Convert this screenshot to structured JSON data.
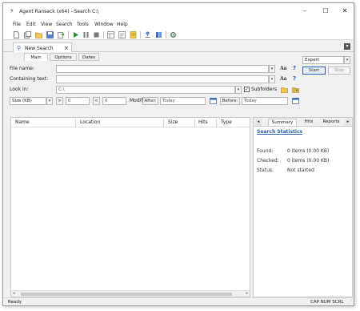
{
  "window": {
    "title": "Agent Ransack (x64) - Search C:\\"
  },
  "menu": [
    "File",
    "Edit",
    "View",
    "Search",
    "Tools",
    "Window",
    "Help"
  ],
  "doc_tab": {
    "label": "New Search",
    "close": "×"
  },
  "criteria": {
    "tabs": [
      "Main",
      "Options",
      "Dates"
    ],
    "file_name_label": "File name:",
    "containing_text_label": "Containing text:",
    "look_in_label": "Look in:",
    "look_in_value": "C:\\",
    "subfolders_label": "Subfolders",
    "size_label": "Size (KB)",
    "size_from": "0",
    "size_to": "0",
    "modified_label": "Modified:",
    "after_label": "After:",
    "after_value": "Today",
    "before_label": "Before:",
    "before_value": "Today",
    "aa_label": "Aa",
    "help_label": "?",
    "gt": ">",
    "lt": "<"
  },
  "mode": {
    "value": "Expert",
    "start": "Start",
    "stop": "Stop"
  },
  "results": {
    "columns": [
      "Name",
      "Location",
      "Size",
      "Hits",
      "Type"
    ]
  },
  "summary": {
    "tabs": [
      "Summary",
      "Hits",
      "Reports"
    ],
    "heading": "Search Statistics",
    "found_label": "Found:",
    "found_value": "0 items (0.00 KB)",
    "checked_label": "Checked:",
    "checked_value": "0 items (0.00 KB)",
    "status_label": "Status:",
    "status_value": "Not started"
  },
  "statusbar": {
    "ready": "Ready",
    "indicators": "CAP NUM SCRL"
  },
  "colors": {
    "accent_blue": "#2b5fb3",
    "play_green": "#2e8b2e"
  }
}
